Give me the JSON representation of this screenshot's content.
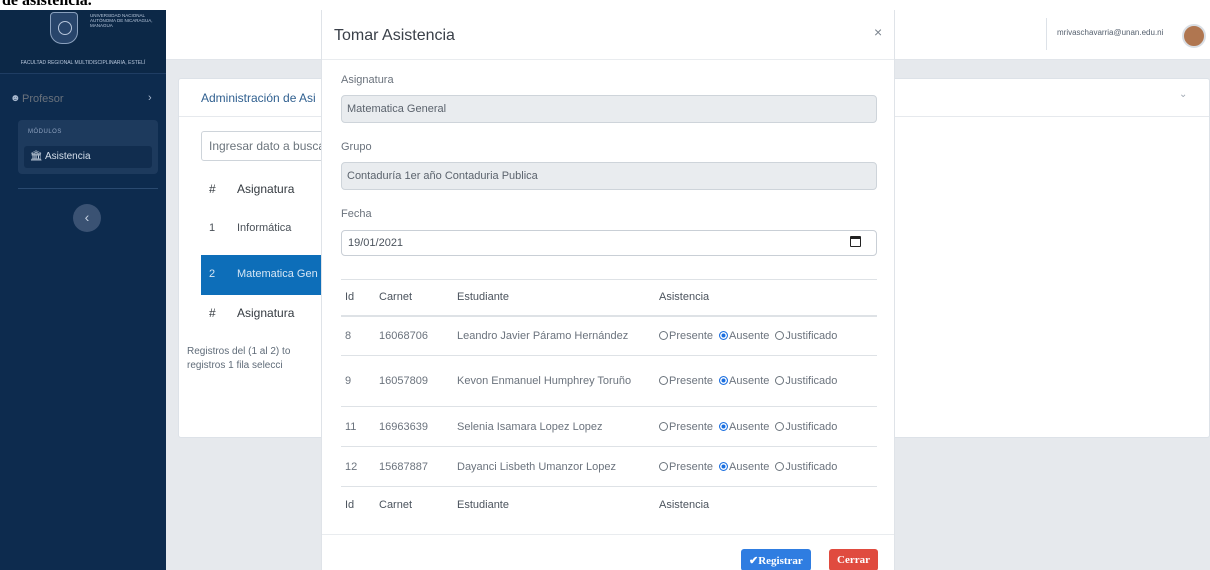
{
  "caption": "de asistencia.",
  "sidebar": {
    "university": "UNIVERSIDAD NACIONAL AUTÓNOMA DE NICARAGUA, MANAGUA",
    "faculty": "FACULTAD REGIONAL MULTIDISCIPLINARIA, ESTELÍ",
    "user_label": "Profesor",
    "modules_header": "MÓDULOS",
    "module_item": "Asistencia",
    "user_chevron": "›",
    "collapse_icon": "‹"
  },
  "topbar": {
    "email": "mrivaschavarria@unan.edu.ni"
  },
  "card": {
    "title": "Administración de Asi",
    "search_placeholder": "Ingresar dato a busca",
    "header": {
      "num": "#",
      "subject": "Asignatura"
    },
    "rows": [
      {
        "num": "1",
        "subject": "Informática"
      },
      {
        "num": "2",
        "subject": "Matematica Gen"
      }
    ],
    "footer": {
      "num": "#",
      "subject": "Asignatura"
    },
    "info_line1": "Registros del (1 al 2) to",
    "info_line2": "registros   1 fila selecci"
  },
  "modal": {
    "title": "Tomar Asistencia",
    "close_symbol": "×",
    "subject_label": "Asignatura",
    "subject_value": "Matematica General",
    "group_label": "Grupo",
    "group_value": "Contaduría 1er año Contaduria Publica",
    "date_label": "Fecha",
    "date_value": "19/01/2021",
    "columns": {
      "id": "Id",
      "carnet": "Carnet",
      "student": "Estudiante",
      "attendance": "Asistencia"
    },
    "options": {
      "present": "Presente",
      "absent": "Ausente",
      "justified": "Justificado"
    },
    "students": [
      {
        "id": "8",
        "carnet": "16068706",
        "name": "Leandro Javier Páramo Hernández",
        "status": "Ausente"
      },
      {
        "id": "9",
        "carnet": "16057809",
        "name": "Kevon Enmanuel Humphrey Toruño",
        "status": "Ausente"
      },
      {
        "id": "11",
        "carnet": "16963639",
        "name": "Selenia Isamara Lopez Lopez",
        "status": "Ausente"
      },
      {
        "id": "12",
        "carnet": "15687887",
        "name": "Dayanci Lisbeth Umanzor Lopez",
        "status": "Ausente"
      }
    ],
    "register_label": "Registrar",
    "close_label": "Cerrar"
  },
  "colors": {
    "sidebar": "#0d2b4e",
    "selected_row": "#0d6eb9",
    "register_button": "#2f7de1",
    "close_button": "#e04b3f"
  }
}
